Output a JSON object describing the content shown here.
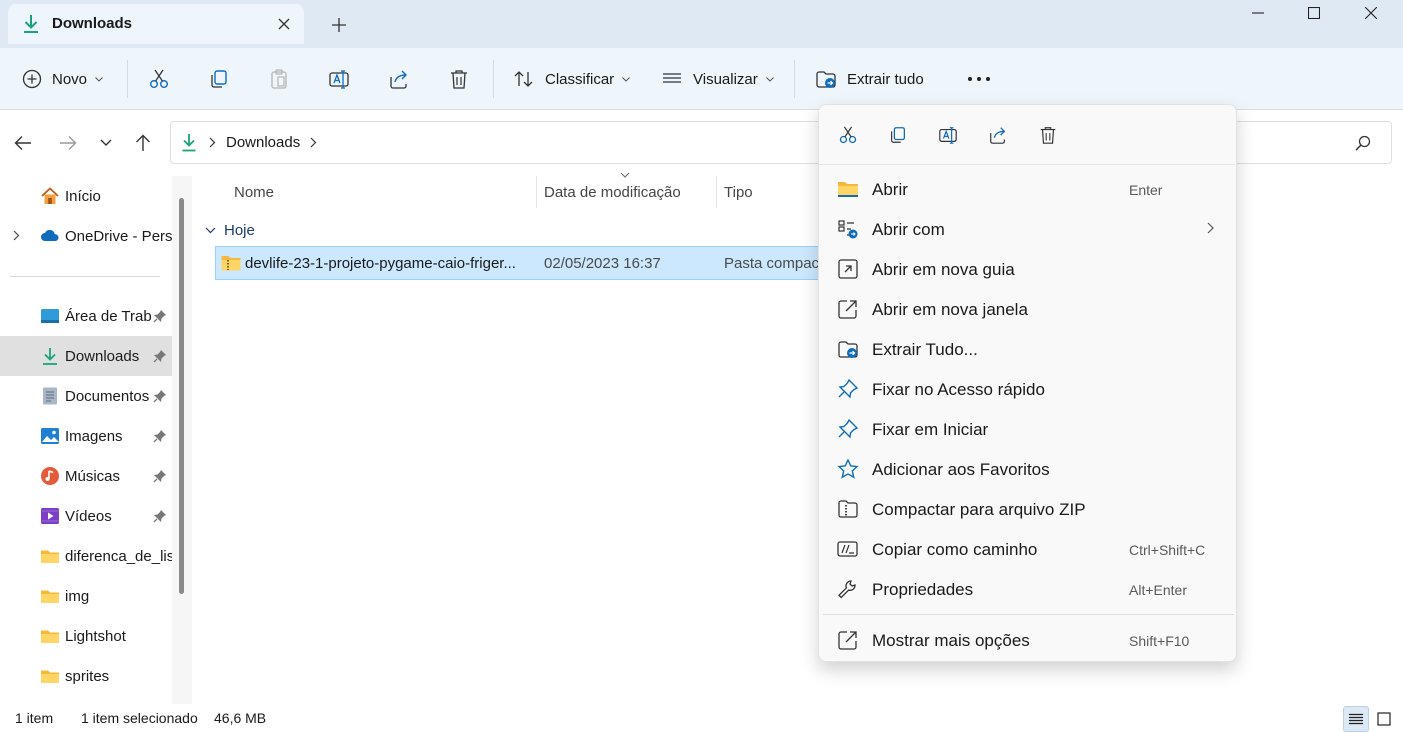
{
  "tab": {
    "title": "Downloads"
  },
  "toolbar": {
    "new_label": "Novo",
    "sort_label": "Classificar",
    "view_label": "Visualizar",
    "extract_label": "Extrair tudo"
  },
  "address": {
    "location": "Downloads"
  },
  "sidebar": {
    "items": [
      {
        "label": "Início"
      },
      {
        "label": "OneDrive - Perso"
      },
      {
        "label": "Área de Trab"
      },
      {
        "label": "Downloads"
      },
      {
        "label": "Documentos"
      },
      {
        "label": "Imagens"
      },
      {
        "label": "Músicas"
      },
      {
        "label": "Vídeos"
      },
      {
        "label": "diferenca_de_lis"
      },
      {
        "label": "img"
      },
      {
        "label": "Lightshot"
      },
      {
        "label": "sprites"
      }
    ]
  },
  "filelist": {
    "columns": {
      "name": "Nome",
      "date": "Data de modificação",
      "type": "Tipo"
    },
    "group": "Hoje",
    "rows": [
      {
        "name": "devlife-23-1-projeto-pygame-caio-friger...",
        "date": "02/05/2023 16:37",
        "type": "Pasta compactada"
      }
    ]
  },
  "status": {
    "count": "1 item",
    "selected": "1 item selecionado",
    "size": "46,6 MB"
  },
  "context_menu": {
    "items": [
      {
        "label": "Abrir",
        "shortcut": "Enter"
      },
      {
        "label": "Abrir com",
        "shortcut": ""
      },
      {
        "label": "Abrir em nova guia",
        "shortcut": ""
      },
      {
        "label": "Abrir em nova janela",
        "shortcut": ""
      },
      {
        "label": "Extrair Tudo...",
        "shortcut": ""
      },
      {
        "label": "Fixar no Acesso rápido",
        "shortcut": ""
      },
      {
        "label": "Fixar em Iniciar",
        "shortcut": ""
      },
      {
        "label": "Adicionar aos Favoritos",
        "shortcut": ""
      },
      {
        "label": "Compactar para arquivo ZIP",
        "shortcut": ""
      },
      {
        "label": "Copiar como caminho",
        "shortcut": "Ctrl+Shift+C"
      },
      {
        "label": "Propriedades",
        "shortcut": "Alt+Enter"
      },
      {
        "label": "Mostrar mais opções",
        "shortcut": "Shift+F10"
      }
    ]
  },
  "colors": {
    "titlebar": "#dfe9f3",
    "commandbar": "#eef5fb",
    "selection": "#cce8ff",
    "accent": "#0f6cbd",
    "download_green": "#1aa37a"
  }
}
